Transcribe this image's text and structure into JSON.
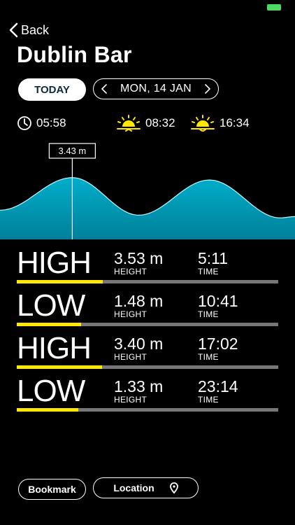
{
  "status": {
    "battery_color": "#4cd964"
  },
  "nav": {
    "back_label": "Back"
  },
  "title": "Dublin Bar",
  "controls": {
    "today_label": "TODAY",
    "date_label": "MON, 14 JAN"
  },
  "info": {
    "current_time": "05:58",
    "sunrise": "08:32",
    "sunset": "16:34"
  },
  "chart_data": {
    "type": "area",
    "cursor_label": "3.43 m",
    "cursor_value_m": 3.43,
    "cursor_fraction": 0.245,
    "fill_color": "#00a6c6",
    "series": [
      {
        "fraction": 0.0,
        "value": 1.75
      },
      {
        "fraction": 0.245,
        "value": 3.53
      },
      {
        "fraction": 0.47,
        "value": 1.48
      },
      {
        "fraction": 0.71,
        "value": 3.4
      },
      {
        "fraction": 0.95,
        "value": 1.33
      },
      {
        "fraction": 1.0,
        "value": 1.4
      }
    ],
    "ylim": [
      0,
      4.5
    ]
  },
  "tides": [
    {
      "type": "HIGH",
      "height": "3.53 m",
      "height_label": "HEIGHT",
      "time": "5:11",
      "time_label": "TIME",
      "level": 0.33
    },
    {
      "type": "LOW",
      "height": "1.48 m",
      "height_label": "HEIGHT",
      "time": "10:41",
      "time_label": "TIME",
      "level": 0.245
    },
    {
      "type": "HIGH",
      "height": "3.40 m",
      "height_label": "HEIGHT",
      "time": "17:02",
      "time_label": "TIME",
      "level": 0.325
    },
    {
      "type": "LOW",
      "height": "1.33 m",
      "height_label": "HEIGHT",
      "time": "23:14",
      "time_label": "TIME",
      "level": 0.235
    }
  ],
  "footer": {
    "bookmark_label": "Bookmark",
    "location_label": "Location"
  },
  "colors": {
    "accent": "#ffe700",
    "today_text": "#0c2a3a",
    "bar_track": "#777777"
  }
}
